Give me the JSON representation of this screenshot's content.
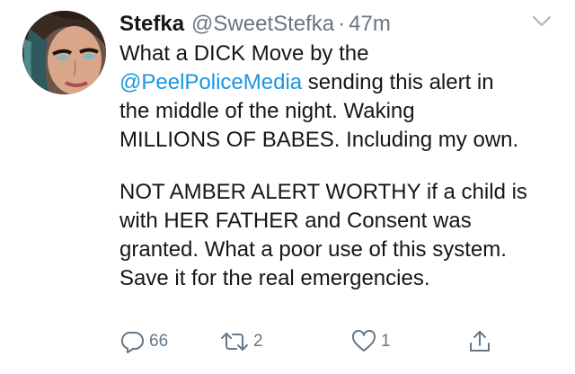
{
  "tweet": {
    "author": {
      "name": "Stefka",
      "handle": "@SweetStefka",
      "separator": "·",
      "time": "47m"
    },
    "text": {
      "line1": "What a DICK Move by the",
      "mention": "@PeelPoliceMedia",
      "line2_rest": " sending this alert in",
      "line3": "the middle of the night. Waking",
      "line4": "MILLIONS OF BABES. Including my own.",
      "line5": "NOT AMBER ALERT WORTHY if a child is",
      "line6": "with HER FATHER and Consent was",
      "line7": "granted. What a poor use of this system.",
      "line8": "Save it for the real emergencies."
    },
    "actions": {
      "replies": "66",
      "retweets": "2",
      "likes": "1"
    }
  },
  "colors": {
    "link": "#1b95e0",
    "secondary": "#657786",
    "text": "#14171a"
  },
  "icons": {
    "reply": "reply-icon",
    "retweet": "retweet-icon",
    "like": "heart-icon",
    "share": "share-icon",
    "menu": "chevron-down-icon"
  }
}
